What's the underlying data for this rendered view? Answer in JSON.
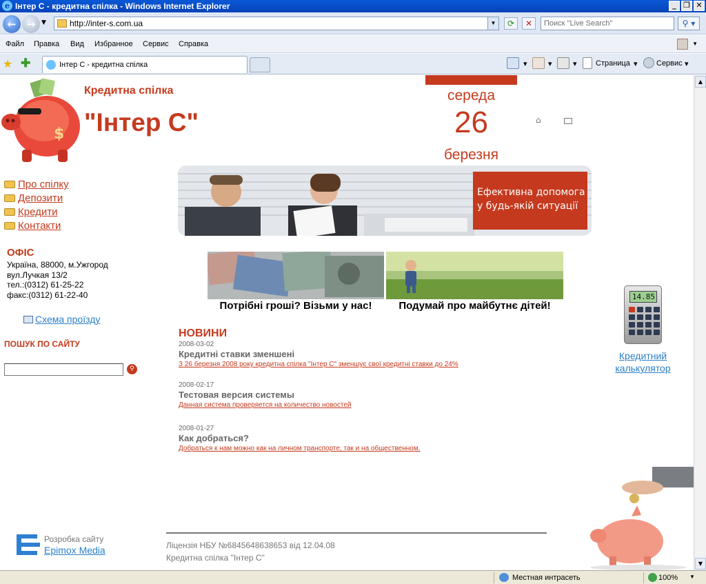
{
  "window": {
    "title": "Інтер С - кредитна спілка - Windows Internet Explorer",
    "address": "http://inter-s.com.ua",
    "search_placeholder": "Поиск \"Live Search\"",
    "menu": [
      "Файл",
      "Правка",
      "Вид",
      "Избранное",
      "Сервис",
      "Справка"
    ],
    "tab_title": "Інтер С - кредитна спілка",
    "cmd_page": "Страница",
    "cmd_tools": "Сервис",
    "status_zone": "Местная интрасеть",
    "status_zoom": "100%"
  },
  "site": {
    "brand_top": "Кредитна спілка",
    "brand_name": "\"Інтер С\"",
    "date": {
      "weekday": "середа",
      "day": "26",
      "month": "березня"
    },
    "hero_text_1": "Ефективна допомога",
    "hero_text_2": "у будь-якій ситуації",
    "nav": [
      "Про спілку",
      "Депозити",
      "Кредити",
      "Контакти"
    ],
    "office": {
      "title": "ОФІС",
      "lines": [
        "Україна, 88000, м.Ужгород",
        "вул.Лучкая 13/2",
        "тел.:(0312) 61-25-22",
        "факс:(0312) 61-22-40"
      ]
    },
    "map_link": "Схема проїзду",
    "search_title": "ПОШУК ПО САЙТУ",
    "promo": [
      "Потрібні гроші? Візьми у нас!",
      "Подумай про майбутнє дітей!"
    ],
    "news_title": "НОВИНИ",
    "news": [
      {
        "date": "2008-03-02",
        "title": "Кредитні ставки зменшені",
        "text": "З 26 березня 2008 року кредитна спілка \"Інтер С\" зменшує свої кредитні ставки до 24%"
      },
      {
        "date": "2008-02-17",
        "title": "Тестовая версия системы",
        "text": "Данная система проверяется на количество новостей"
      },
      {
        "date": "2008-01-27",
        "title": "Как добраться?",
        "text": "Добраться к нам можно как на личном транспорте, так и на общественном."
      }
    ],
    "calc_display": "14.85",
    "calc_link_1": "Кредитний",
    "calc_link_2": "калькулятор",
    "license_1": "Ліцензія НБУ №6845648638653 від 12.04.08",
    "license_2": "Кредитна спілка \"Інтер С\"",
    "dev_label": "Розробка сайту",
    "dev_link": "Epimox Media"
  },
  "colors": {
    "accent": "#c53a1e",
    "link": "#2a7fc9",
    "ie_blue": "#0743b8"
  }
}
